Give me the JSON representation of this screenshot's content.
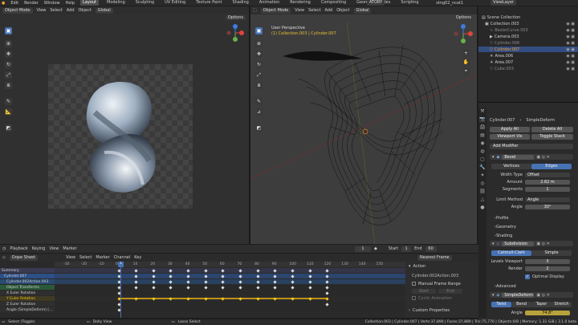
{
  "topbar": {
    "menus": [
      "Edit",
      "Render",
      "Window",
      "Help"
    ],
    "workspaces": [
      "Layout",
      "Modeling",
      "Sculpting",
      "UV Editing",
      "Texture Paint",
      "Shading",
      "Animation",
      "Rendering",
      "Compositing",
      "Geometry Nodes",
      "Scripting"
    ],
    "active_workspace": "Layout",
    "scene_name": "Scene",
    "scene_label": "ATORY",
    "view_layer": "ViewLayer",
    "file_title": "stng02_ncat1"
  },
  "image_editor": {
    "mode": "Object Mode",
    "menus": [
      "View",
      "Select",
      "Add",
      "Object"
    ],
    "orientation": "Global",
    "options_label": "Options"
  },
  "viewport": {
    "mode": "Object Mode",
    "menus": [
      "View",
      "Select",
      "Add",
      "Object"
    ],
    "orientation": "Global",
    "options_label": "Options",
    "perspective": "User Perspective",
    "collection_path": "(1) Collection.003 | Cylinder.007"
  },
  "outliner": {
    "title": "Scene Collection",
    "items": [
      {
        "label": "Collection.003",
        "color": "#cfcfcf",
        "icon": "collection-icon"
      },
      {
        "label": "BezierCurve.003",
        "color": "#8a8a8a",
        "icon": "curve-icon"
      },
      {
        "label": "Camera.003",
        "color": "#cfcfcf",
        "icon": "camera-icon"
      },
      {
        "label": "Cylinder.006",
        "color": "#8a8a8a",
        "icon": "mesh-icon"
      },
      {
        "label": "Cylinder.007",
        "color": "#f0a030",
        "icon": "mesh-icon"
      },
      {
        "label": "Area.006",
        "color": "#cfcfcf",
        "icon": "light-icon"
      },
      {
        "label": "Area.007",
        "color": "#cfcfcf",
        "icon": "light-icon"
      },
      {
        "label": "Cube.003",
        "color": "#8a8a8a",
        "icon": "mesh-icon"
      }
    ]
  },
  "properties": {
    "object_name": "Cylinder.007",
    "modifier_type": "SimpleDeform",
    "apply_all": "Apply All",
    "delete_all": "Delete All",
    "viewport_vis": "Viewport Vis",
    "toggle_stack": "Toggle Stack",
    "add_modifier": "Add Modifier",
    "bevel": {
      "name": "Bevel",
      "tabs": [
        "Vertices",
        "Edges"
      ],
      "active_tab": "Edges",
      "width_type_label": "Width Type",
      "width_type": "Offset",
      "amount_label": "Amount",
      "amount": "2.62 m",
      "segments_label": "Segments",
      "segments": "1",
      "limit_method_label": "Limit Method",
      "limit_method": "Angle",
      "angle_label": "Angle",
      "angle": "30°",
      "sections": [
        "Profile",
        "Geometry",
        "Shading"
      ]
    },
    "subdivision": {
      "name": "Subdivision",
      "tabs": [
        "Catmull-Clark",
        "Simple"
      ],
      "active_tab": "Catmull-Clark",
      "levels_viewport_label": "Levels Viewport",
      "levels_viewport": "3",
      "render_label": "Render",
      "render": "2",
      "optimal_display": "Optimal Display",
      "advanced": "Advanced"
    },
    "simpledeform": {
      "name": "SimpleDeform",
      "tabs": [
        "Twist",
        "Bend",
        "Taper",
        "Stretch"
      ],
      "active_tab": "Twist",
      "angle_label": "Angle",
      "angle": "74.8°"
    }
  },
  "timeline_header": {
    "playback": "Playback",
    "keying": "Keying",
    "view": "View",
    "marker": "Marker",
    "current_frame": "1",
    "start_label": "Start",
    "start": "1",
    "end_label": "End",
    "end": "60"
  },
  "dopesheet": {
    "mode": "Dope Sheet",
    "menus": [
      "View",
      "Select",
      "Marker",
      "Channel",
      "Key"
    ],
    "frame_ticks": [
      "-30",
      "-20",
      "-10",
      "0",
      "10",
      "20",
      "30",
      "40",
      "50",
      "60",
      "70",
      "80",
      "90",
      "100",
      "110",
      "120",
      "130",
      "140",
      "150"
    ],
    "current_frame": "1",
    "channels": [
      {
        "label": "Summary",
        "bg": "#3a3a52",
        "dot": "#e0e0e0"
      },
      {
        "label": "Cylinder.007",
        "bg": "#2d4f86",
        "dot": "#e0e0e0"
      },
      {
        "label": "Cylinder.002Action.003",
        "bg": "#2a4a70",
        "dot": "#e0e0e0"
      },
      {
        "label": "Object Transforms",
        "bg": "#2b5a38",
        "dot": "#e0e0e0"
      },
      {
        "label": "X Euler Rotation",
        "bg": "#2f2f2f",
        "dot": "#e0e0e0"
      },
      {
        "label": "Y Euler Rotation",
        "bg": "#3f3a22",
        "dot": "#f2c618"
      },
      {
        "label": "Z Euler Rotation",
        "bg": "#2f2f2f",
        "dot": "#e0e0e0"
      },
      {
        "label": "Angle (SimpleDeform) (...",
        "bg": "#2f2f2f",
        "dot": "#e0e0e0"
      }
    ],
    "keyframe_frames": [
      0,
      10,
      20,
      30,
      40,
      50,
      60,
      70,
      80,
      90,
      100,
      110,
      120
    ]
  },
  "action_panel": {
    "nearest_frame": "Nearest Frame",
    "action_label": "Action",
    "action_name": "Cylinder.002Action.003",
    "manual_frame_range": "Manual Frame Range",
    "start_label": "Start",
    "end_label": "End",
    "cyclic": "Cyclic Animation",
    "custom_props": "Custom Properties"
  },
  "statusbar": {
    "left1": "Select (Toggle)",
    "left2": "Dolly View",
    "left3": "Lasso Select",
    "right": "Collection.003 | Cylinder.007 | Verts:37,890 | Faces:37,889 | Tris:75,776 | Objects:0/8 | Memory: 1.31 GiB | 3.1.0 beta"
  },
  "colors": {
    "accent": "#4772b3",
    "active_object": "#f0a030",
    "playhead": "#4772b3"
  }
}
